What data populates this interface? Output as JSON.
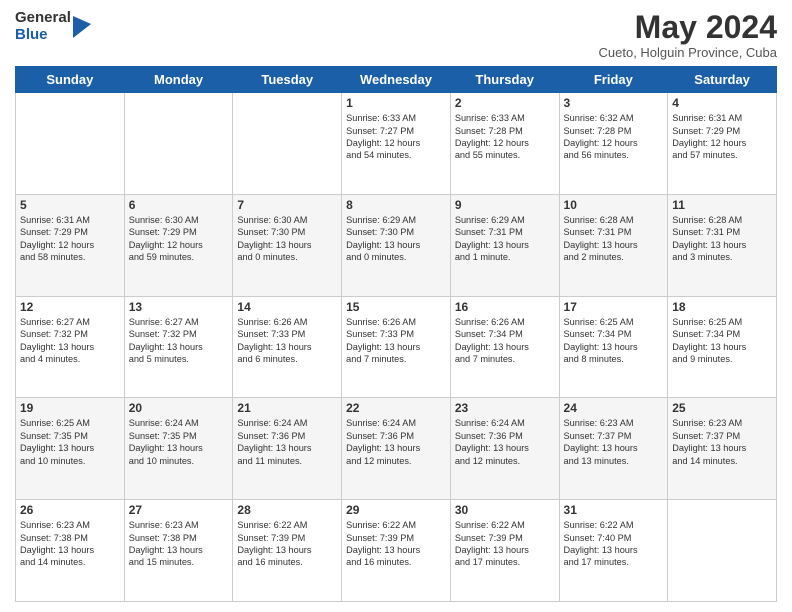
{
  "logo": {
    "general": "General",
    "blue": "Blue"
  },
  "title": "May 2024",
  "location": "Cueto, Holguin Province, Cuba",
  "days_header": [
    "Sunday",
    "Monday",
    "Tuesday",
    "Wednesday",
    "Thursday",
    "Friday",
    "Saturday"
  ],
  "weeks": [
    [
      {
        "day": "",
        "info": ""
      },
      {
        "day": "",
        "info": ""
      },
      {
        "day": "",
        "info": ""
      },
      {
        "day": "1",
        "info": "Sunrise: 6:33 AM\nSunset: 7:27 PM\nDaylight: 12 hours\nand 54 minutes."
      },
      {
        "day": "2",
        "info": "Sunrise: 6:33 AM\nSunset: 7:28 PM\nDaylight: 12 hours\nand 55 minutes."
      },
      {
        "day": "3",
        "info": "Sunrise: 6:32 AM\nSunset: 7:28 PM\nDaylight: 12 hours\nand 56 minutes."
      },
      {
        "day": "4",
        "info": "Sunrise: 6:31 AM\nSunset: 7:29 PM\nDaylight: 12 hours\nand 57 minutes."
      }
    ],
    [
      {
        "day": "5",
        "info": "Sunrise: 6:31 AM\nSunset: 7:29 PM\nDaylight: 12 hours\nand 58 minutes."
      },
      {
        "day": "6",
        "info": "Sunrise: 6:30 AM\nSunset: 7:29 PM\nDaylight: 12 hours\nand 59 minutes."
      },
      {
        "day": "7",
        "info": "Sunrise: 6:30 AM\nSunset: 7:30 PM\nDaylight: 13 hours\nand 0 minutes."
      },
      {
        "day": "8",
        "info": "Sunrise: 6:29 AM\nSunset: 7:30 PM\nDaylight: 13 hours\nand 0 minutes."
      },
      {
        "day": "9",
        "info": "Sunrise: 6:29 AM\nSunset: 7:31 PM\nDaylight: 13 hours\nand 1 minute."
      },
      {
        "day": "10",
        "info": "Sunrise: 6:28 AM\nSunset: 7:31 PM\nDaylight: 13 hours\nand 2 minutes."
      },
      {
        "day": "11",
        "info": "Sunrise: 6:28 AM\nSunset: 7:31 PM\nDaylight: 13 hours\nand 3 minutes."
      }
    ],
    [
      {
        "day": "12",
        "info": "Sunrise: 6:27 AM\nSunset: 7:32 PM\nDaylight: 13 hours\nand 4 minutes."
      },
      {
        "day": "13",
        "info": "Sunrise: 6:27 AM\nSunset: 7:32 PM\nDaylight: 13 hours\nand 5 minutes."
      },
      {
        "day": "14",
        "info": "Sunrise: 6:26 AM\nSunset: 7:33 PM\nDaylight: 13 hours\nand 6 minutes."
      },
      {
        "day": "15",
        "info": "Sunrise: 6:26 AM\nSunset: 7:33 PM\nDaylight: 13 hours\nand 7 minutes."
      },
      {
        "day": "16",
        "info": "Sunrise: 6:26 AM\nSunset: 7:34 PM\nDaylight: 13 hours\nand 7 minutes."
      },
      {
        "day": "17",
        "info": "Sunrise: 6:25 AM\nSunset: 7:34 PM\nDaylight: 13 hours\nand 8 minutes."
      },
      {
        "day": "18",
        "info": "Sunrise: 6:25 AM\nSunset: 7:34 PM\nDaylight: 13 hours\nand 9 minutes."
      }
    ],
    [
      {
        "day": "19",
        "info": "Sunrise: 6:25 AM\nSunset: 7:35 PM\nDaylight: 13 hours\nand 10 minutes."
      },
      {
        "day": "20",
        "info": "Sunrise: 6:24 AM\nSunset: 7:35 PM\nDaylight: 13 hours\nand 10 minutes."
      },
      {
        "day": "21",
        "info": "Sunrise: 6:24 AM\nSunset: 7:36 PM\nDaylight: 13 hours\nand 11 minutes."
      },
      {
        "day": "22",
        "info": "Sunrise: 6:24 AM\nSunset: 7:36 PM\nDaylight: 13 hours\nand 12 minutes."
      },
      {
        "day": "23",
        "info": "Sunrise: 6:24 AM\nSunset: 7:36 PM\nDaylight: 13 hours\nand 12 minutes."
      },
      {
        "day": "24",
        "info": "Sunrise: 6:23 AM\nSunset: 7:37 PM\nDaylight: 13 hours\nand 13 minutes."
      },
      {
        "day": "25",
        "info": "Sunrise: 6:23 AM\nSunset: 7:37 PM\nDaylight: 13 hours\nand 14 minutes."
      }
    ],
    [
      {
        "day": "26",
        "info": "Sunrise: 6:23 AM\nSunset: 7:38 PM\nDaylight: 13 hours\nand 14 minutes."
      },
      {
        "day": "27",
        "info": "Sunrise: 6:23 AM\nSunset: 7:38 PM\nDaylight: 13 hours\nand 15 minutes."
      },
      {
        "day": "28",
        "info": "Sunrise: 6:22 AM\nSunset: 7:39 PM\nDaylight: 13 hours\nand 16 minutes."
      },
      {
        "day": "29",
        "info": "Sunrise: 6:22 AM\nSunset: 7:39 PM\nDaylight: 13 hours\nand 16 minutes."
      },
      {
        "day": "30",
        "info": "Sunrise: 6:22 AM\nSunset: 7:39 PM\nDaylight: 13 hours\nand 17 minutes."
      },
      {
        "day": "31",
        "info": "Sunrise: 6:22 AM\nSunset: 7:40 PM\nDaylight: 13 hours\nand 17 minutes."
      },
      {
        "day": "",
        "info": ""
      }
    ]
  ]
}
